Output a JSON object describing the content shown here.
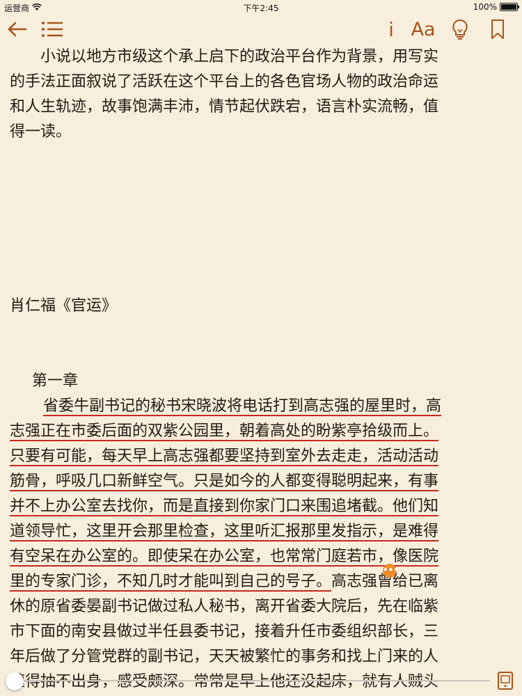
{
  "status_bar": {
    "carrier": "运营商",
    "time": "下午2:45",
    "battery": "100%",
    "battery_level": 1.0
  },
  "toolbar": {
    "back_icon": "arrow-left-icon",
    "toc_icon": "list-icon",
    "info_label": "i",
    "font_label": "Aa",
    "brightness_icon": "lightbulb-icon",
    "bookmark_icon": "bookmark-icon"
  },
  "content": {
    "intro_lines": [
      "小说以地方市级这个承上启下的政治平台作为背景，用写实",
      "的手法正面叙说了活跃在这个平台上的各色官场人物的政治命运",
      "和人生轨迹，故事饱满丰沛，情节起伏跌宕，语言朴实流畅，值",
      "得一读。"
    ],
    "book_title": "肖仁福《官运》",
    "chapter_title": "第一章",
    "body_lines": [
      {
        "text": "省委牛副书记的秘书宋晓波将电话打到高志强的屋里时，高",
        "highlight": true
      },
      {
        "text": "志强正在市委后面的双紫公园里，朝着高处的盼紫亭拾级而上。",
        "highlight": true
      },
      {
        "text": "只要有可能，每天早上高志强都要坚持到室外去走走，活动活动",
        "highlight": true
      },
      {
        "text": "筋骨，呼吸几口新鲜空气。只是如今的人都变得聪明起来，有事",
        "highlight": true
      },
      {
        "text": "并不上办公室去找你，而是直接到你家门口来围追堵截。他们知",
        "highlight": true
      },
      {
        "text": "道领导忙，这里开会那里检查，这里听汇报那里发指示，是难得",
        "highlight": true
      },
      {
        "text": "有空呆在办公室的。即使呆在办公室，也常常门庭若市，像医院",
        "highlight": true
      },
      {
        "text": "里的专家门诊，不知几时才能叫到自己的号子。",
        "highlight": true,
        "tail": "高志强曾给已离"
      },
      {
        "text": "休的原省委晏副书记做过私人秘书，离开省委大院后，先在临紫",
        "highlight": false
      },
      {
        "text": "市下面的南安县做过半任县委书记，接着升任市委组织部长，三",
        "highlight": false
      },
      {
        "text": "年后做了分管党群的副书记，天天被繁忙的事务和找上门来的人",
        "highlight": false
      },
      {
        "text": "缠得抽不出身，感受颇深。常常是早上他还没起床，就有人贼头",
        "highlight": false
      }
    ],
    "note_marker": "•••"
  },
  "progress": {
    "value": 0.0,
    "page_icon": "page-mode-icon"
  }
}
